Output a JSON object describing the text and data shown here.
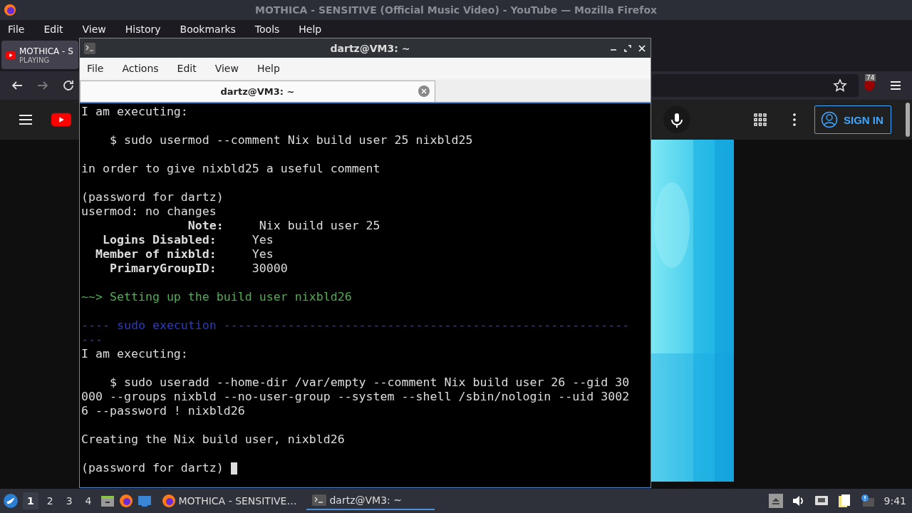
{
  "browser": {
    "title": "MOTHICA - SENSITIVE (Official Music Video) - YouTube — Mozilla Firefox",
    "menu": [
      "File",
      "Edit",
      "View",
      "History",
      "Bookmarks",
      "Tools",
      "Help"
    ],
    "tab": {
      "title": "MOTHICA - S",
      "subtitle": "PLAYING"
    },
    "badge": "74",
    "sign_in": "SIGN IN"
  },
  "terminal": {
    "title": "dartz@VM3: ~",
    "menu": [
      "File",
      "Actions",
      "Edit",
      "View",
      "Help"
    ],
    "tab": "dartz@VM3: ~",
    "cursor": true,
    "lines": [
      {
        "kind": "plain",
        "text": "I am executing:"
      },
      {
        "kind": "blank"
      },
      {
        "kind": "plain",
        "text": "    $ sudo usermod --comment Nix build user 25 nixbld25"
      },
      {
        "kind": "blank"
      },
      {
        "kind": "plain",
        "text": "in order to give nixbld25 a useful comment"
      },
      {
        "kind": "blank"
      },
      {
        "kind": "plain",
        "text": "(password for dartz)"
      },
      {
        "kind": "plain",
        "text": "usermod: no changes"
      },
      {
        "kind": "plain",
        "text": "               **Note:**     Nix build user 25"
      },
      {
        "kind": "plain",
        "text": "   **Logins Disabled:**     Yes"
      },
      {
        "kind": "plain",
        "text": "  **Member of nixbld:**     Yes"
      },
      {
        "kind": "plain",
        "text": "    **PrimaryGroupID:**     30000"
      },
      {
        "kind": "blank"
      },
      {
        "kind": "green",
        "text": "~~> Setting up the build user nixbld26"
      },
      {
        "kind": "blank"
      },
      {
        "kind": "rule",
        "text": "---- sudo execution ---------------------------------------------------------"
      },
      {
        "kind": "rule",
        "text": "---"
      },
      {
        "kind": "plain",
        "text": "I am executing:"
      },
      {
        "kind": "blank"
      },
      {
        "kind": "plain",
        "text": "    $ sudo useradd --home-dir /var/empty --comment Nix build user 26 --gid 30"
      },
      {
        "kind": "plain",
        "text": "000 --groups nixbld --no-user-group --system --shell /sbin/nologin --uid 3002"
      },
      {
        "kind": "plain",
        "text": "6 --password ! nixbld26"
      },
      {
        "kind": "blank"
      },
      {
        "kind": "plain",
        "text": "Creating the Nix build user, nixbld26"
      },
      {
        "kind": "blank"
      },
      {
        "kind": "plain",
        "text": "(password for dartz) "
      }
    ]
  },
  "taskbar": {
    "workspaces": [
      {
        "label": "1",
        "selected": true
      },
      {
        "label": "2",
        "selected": false
      },
      {
        "label": "3",
        "selected": false
      },
      {
        "label": "4",
        "selected": false
      }
    ],
    "tasks": [
      {
        "kind": "firefox",
        "label": "MOTHICA - SENSITIVE…",
        "selected": false
      },
      {
        "kind": "terminal",
        "label": "dartz@VM3: ~",
        "selected": true
      }
    ],
    "clock": "9:41"
  }
}
